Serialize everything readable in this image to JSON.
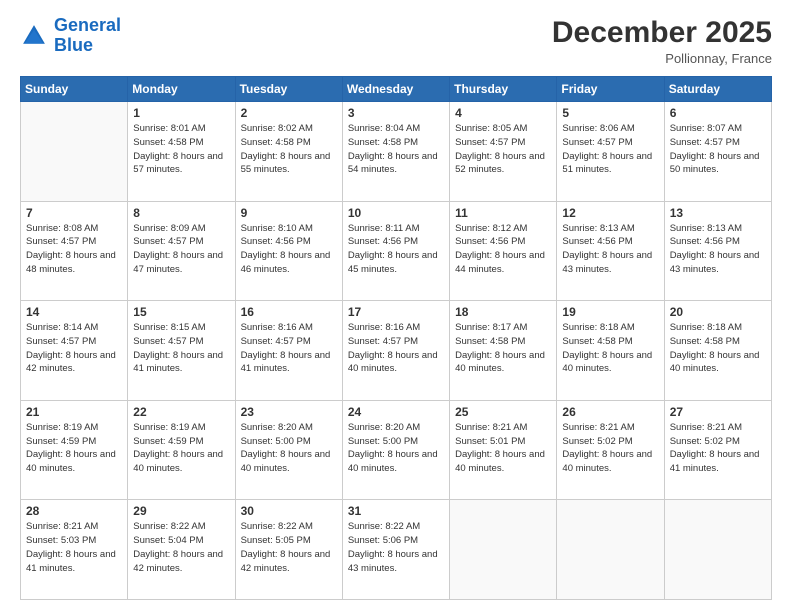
{
  "logo": {
    "text_general": "General",
    "text_blue": "Blue"
  },
  "header": {
    "month": "December 2025",
    "location": "Pollionnay, France"
  },
  "days_of_week": [
    "Sunday",
    "Monday",
    "Tuesday",
    "Wednesday",
    "Thursday",
    "Friday",
    "Saturday"
  ],
  "weeks": [
    [
      {
        "day": "",
        "sunrise": "",
        "sunset": "",
        "daylight": "",
        "empty": true
      },
      {
        "day": "1",
        "sunrise": "Sunrise: 8:01 AM",
        "sunset": "Sunset: 4:58 PM",
        "daylight": "Daylight: 8 hours and 57 minutes."
      },
      {
        "day": "2",
        "sunrise": "Sunrise: 8:02 AM",
        "sunset": "Sunset: 4:58 PM",
        "daylight": "Daylight: 8 hours and 55 minutes."
      },
      {
        "day": "3",
        "sunrise": "Sunrise: 8:04 AM",
        "sunset": "Sunset: 4:58 PM",
        "daylight": "Daylight: 8 hours and 54 minutes."
      },
      {
        "day": "4",
        "sunrise": "Sunrise: 8:05 AM",
        "sunset": "Sunset: 4:57 PM",
        "daylight": "Daylight: 8 hours and 52 minutes."
      },
      {
        "day": "5",
        "sunrise": "Sunrise: 8:06 AM",
        "sunset": "Sunset: 4:57 PM",
        "daylight": "Daylight: 8 hours and 51 minutes."
      },
      {
        "day": "6",
        "sunrise": "Sunrise: 8:07 AM",
        "sunset": "Sunset: 4:57 PM",
        "daylight": "Daylight: 8 hours and 50 minutes."
      }
    ],
    [
      {
        "day": "7",
        "sunrise": "Sunrise: 8:08 AM",
        "sunset": "Sunset: 4:57 PM",
        "daylight": "Daylight: 8 hours and 48 minutes."
      },
      {
        "day": "8",
        "sunrise": "Sunrise: 8:09 AM",
        "sunset": "Sunset: 4:57 PM",
        "daylight": "Daylight: 8 hours and 47 minutes."
      },
      {
        "day": "9",
        "sunrise": "Sunrise: 8:10 AM",
        "sunset": "Sunset: 4:56 PM",
        "daylight": "Daylight: 8 hours and 46 minutes."
      },
      {
        "day": "10",
        "sunrise": "Sunrise: 8:11 AM",
        "sunset": "Sunset: 4:56 PM",
        "daylight": "Daylight: 8 hours and 45 minutes."
      },
      {
        "day": "11",
        "sunrise": "Sunrise: 8:12 AM",
        "sunset": "Sunset: 4:56 PM",
        "daylight": "Daylight: 8 hours and 44 minutes."
      },
      {
        "day": "12",
        "sunrise": "Sunrise: 8:13 AM",
        "sunset": "Sunset: 4:56 PM",
        "daylight": "Daylight: 8 hours and 43 minutes."
      },
      {
        "day": "13",
        "sunrise": "Sunrise: 8:13 AM",
        "sunset": "Sunset: 4:56 PM",
        "daylight": "Daylight: 8 hours and 43 minutes."
      }
    ],
    [
      {
        "day": "14",
        "sunrise": "Sunrise: 8:14 AM",
        "sunset": "Sunset: 4:57 PM",
        "daylight": "Daylight: 8 hours and 42 minutes."
      },
      {
        "day": "15",
        "sunrise": "Sunrise: 8:15 AM",
        "sunset": "Sunset: 4:57 PM",
        "daylight": "Daylight: 8 hours and 41 minutes."
      },
      {
        "day": "16",
        "sunrise": "Sunrise: 8:16 AM",
        "sunset": "Sunset: 4:57 PM",
        "daylight": "Daylight: 8 hours and 41 minutes."
      },
      {
        "day": "17",
        "sunrise": "Sunrise: 8:16 AM",
        "sunset": "Sunset: 4:57 PM",
        "daylight": "Daylight: 8 hours and 40 minutes."
      },
      {
        "day": "18",
        "sunrise": "Sunrise: 8:17 AM",
        "sunset": "Sunset: 4:58 PM",
        "daylight": "Daylight: 8 hours and 40 minutes."
      },
      {
        "day": "19",
        "sunrise": "Sunrise: 8:18 AM",
        "sunset": "Sunset: 4:58 PM",
        "daylight": "Daylight: 8 hours and 40 minutes."
      },
      {
        "day": "20",
        "sunrise": "Sunrise: 8:18 AM",
        "sunset": "Sunset: 4:58 PM",
        "daylight": "Daylight: 8 hours and 40 minutes."
      }
    ],
    [
      {
        "day": "21",
        "sunrise": "Sunrise: 8:19 AM",
        "sunset": "Sunset: 4:59 PM",
        "daylight": "Daylight: 8 hours and 40 minutes."
      },
      {
        "day": "22",
        "sunrise": "Sunrise: 8:19 AM",
        "sunset": "Sunset: 4:59 PM",
        "daylight": "Daylight: 8 hours and 40 minutes."
      },
      {
        "day": "23",
        "sunrise": "Sunrise: 8:20 AM",
        "sunset": "Sunset: 5:00 PM",
        "daylight": "Daylight: 8 hours and 40 minutes."
      },
      {
        "day": "24",
        "sunrise": "Sunrise: 8:20 AM",
        "sunset": "Sunset: 5:00 PM",
        "daylight": "Daylight: 8 hours and 40 minutes."
      },
      {
        "day": "25",
        "sunrise": "Sunrise: 8:21 AM",
        "sunset": "Sunset: 5:01 PM",
        "daylight": "Daylight: 8 hours and 40 minutes."
      },
      {
        "day": "26",
        "sunrise": "Sunrise: 8:21 AM",
        "sunset": "Sunset: 5:02 PM",
        "daylight": "Daylight: 8 hours and 40 minutes."
      },
      {
        "day": "27",
        "sunrise": "Sunrise: 8:21 AM",
        "sunset": "Sunset: 5:02 PM",
        "daylight": "Daylight: 8 hours and 41 minutes."
      }
    ],
    [
      {
        "day": "28",
        "sunrise": "Sunrise: 8:21 AM",
        "sunset": "Sunset: 5:03 PM",
        "daylight": "Daylight: 8 hours and 41 minutes."
      },
      {
        "day": "29",
        "sunrise": "Sunrise: 8:22 AM",
        "sunset": "Sunset: 5:04 PM",
        "daylight": "Daylight: 8 hours and 42 minutes."
      },
      {
        "day": "30",
        "sunrise": "Sunrise: 8:22 AM",
        "sunset": "Sunset: 5:05 PM",
        "daylight": "Daylight: 8 hours and 42 minutes."
      },
      {
        "day": "31",
        "sunrise": "Sunrise: 8:22 AM",
        "sunset": "Sunset: 5:06 PM",
        "daylight": "Daylight: 8 hours and 43 minutes."
      },
      {
        "day": "",
        "empty": true
      },
      {
        "day": "",
        "empty": true
      },
      {
        "day": "",
        "empty": true
      }
    ]
  ]
}
